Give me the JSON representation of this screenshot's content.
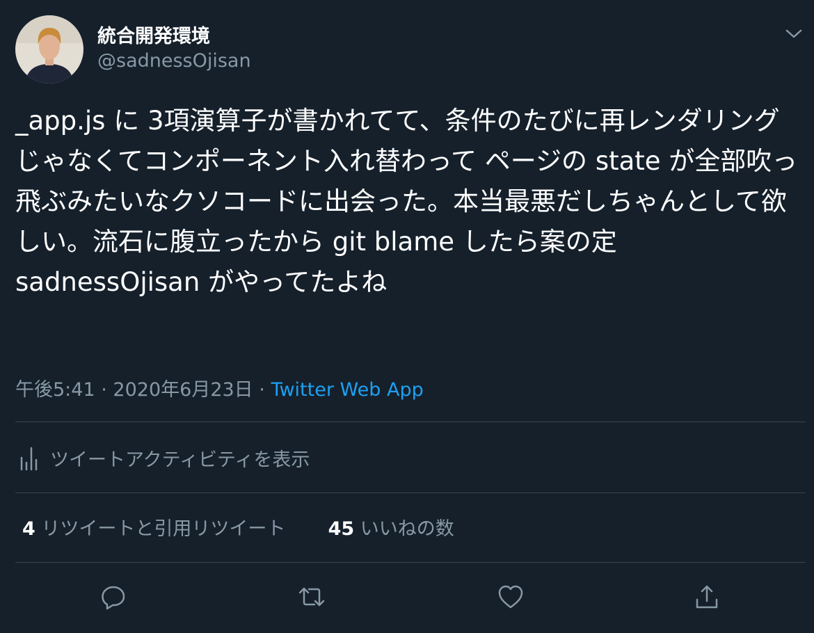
{
  "user": {
    "display_name": "統合開発環境",
    "handle": "@sadnessOjisan"
  },
  "tweet": {
    "text": "_app.js に 3項演算子が書かれてて、条件のたびに再レンダリングじゃなくてコンポーネント入れ替わって ページの state が全部吹っ飛ぶみたいなクソコードに出会った。本当最悪だしちゃんとして欲しい。流石に腹立ったから git blame したら案の定 sadnessOjisan がやってたよね",
    "time": "午後5:41",
    "separator": "·",
    "date": "2020年6月23日",
    "source": "Twitter Web App"
  },
  "activity": {
    "label": "ツイートアクティビティを表示"
  },
  "stats": {
    "retweets_count": "4",
    "retweets_label": "リツイートと引用リツイート",
    "likes_count": "45",
    "likes_label": "いいねの数"
  },
  "icons": {
    "menu": "chevron-down-icon",
    "activity": "analytics-icon",
    "reply": "reply-icon",
    "retweet": "retweet-icon",
    "like": "heart-icon",
    "share": "share-icon"
  },
  "colors": {
    "background": "#15202b",
    "text": "#ffffff",
    "secondary": "#8899a6",
    "link": "#1da1f2",
    "divider": "#38444d"
  }
}
